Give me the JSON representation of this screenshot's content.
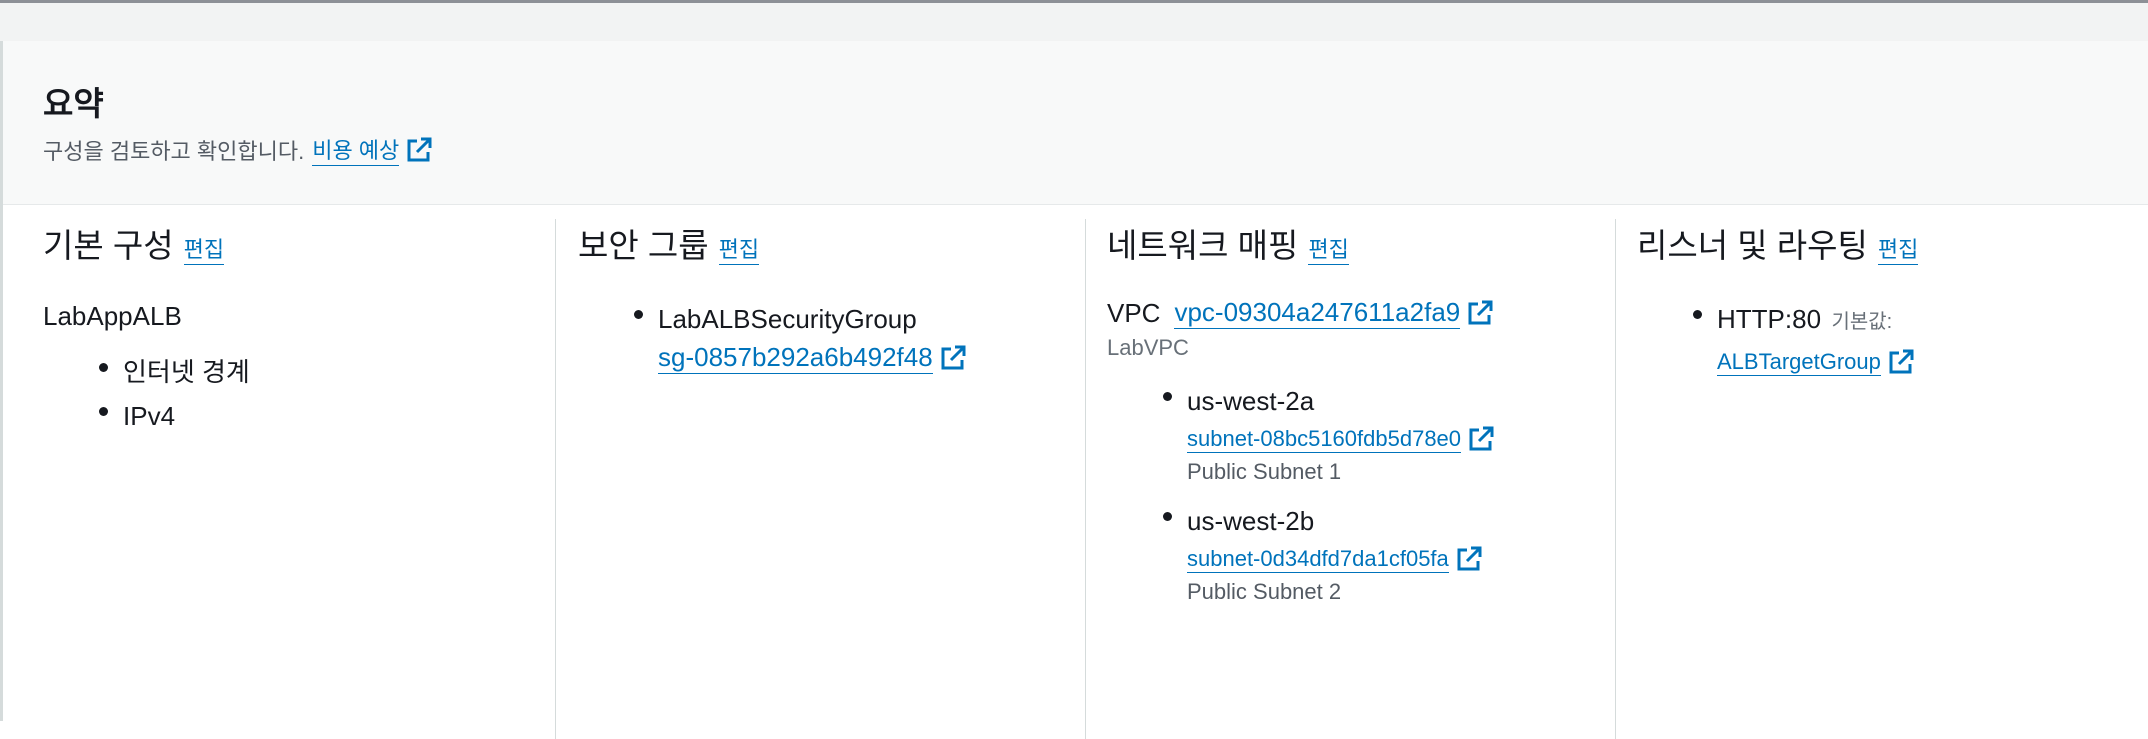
{
  "summary": {
    "title": "요약",
    "description": "구성을 검토하고 확인합니다.",
    "cost_link": "비용 예상"
  },
  "basic": {
    "title": "기본 구성",
    "edit": "편집",
    "name": "LabAppALB",
    "items": [
      "인터넷 경계",
      "IPv4"
    ]
  },
  "security": {
    "title": "보안 그룹",
    "edit": "편집",
    "group_name": "LabALBSecurityGroup",
    "group_id": "sg-0857b292a6b492f48"
  },
  "network": {
    "title": "네트워크 매핑",
    "edit": "편집",
    "vpc_label": "VPC",
    "vpc_id": "vpc-09304a247611a2fa9",
    "vpc_name": "LabVPC",
    "zones": [
      {
        "zone": "us-west-2a",
        "subnet_id": "subnet-08bc5160fdb5d78e0",
        "subnet_name": "Public Subnet 1"
      },
      {
        "zone": "us-west-2b",
        "subnet_id": "subnet-0d34dfd7da1cf05fa",
        "subnet_name": "Public Subnet 2"
      }
    ]
  },
  "listener": {
    "title": "리스너 및 라우팅",
    "edit": "편집",
    "protocol": "HTTP:80",
    "default_label": "기본값:",
    "target_group": "ALBTargetGroup"
  },
  "colors": {
    "link": "#0073bb",
    "text": "#16191f",
    "muted": "#545b64",
    "border": "#d5dbdb"
  },
  "icons": {
    "external": "external-link-icon"
  }
}
